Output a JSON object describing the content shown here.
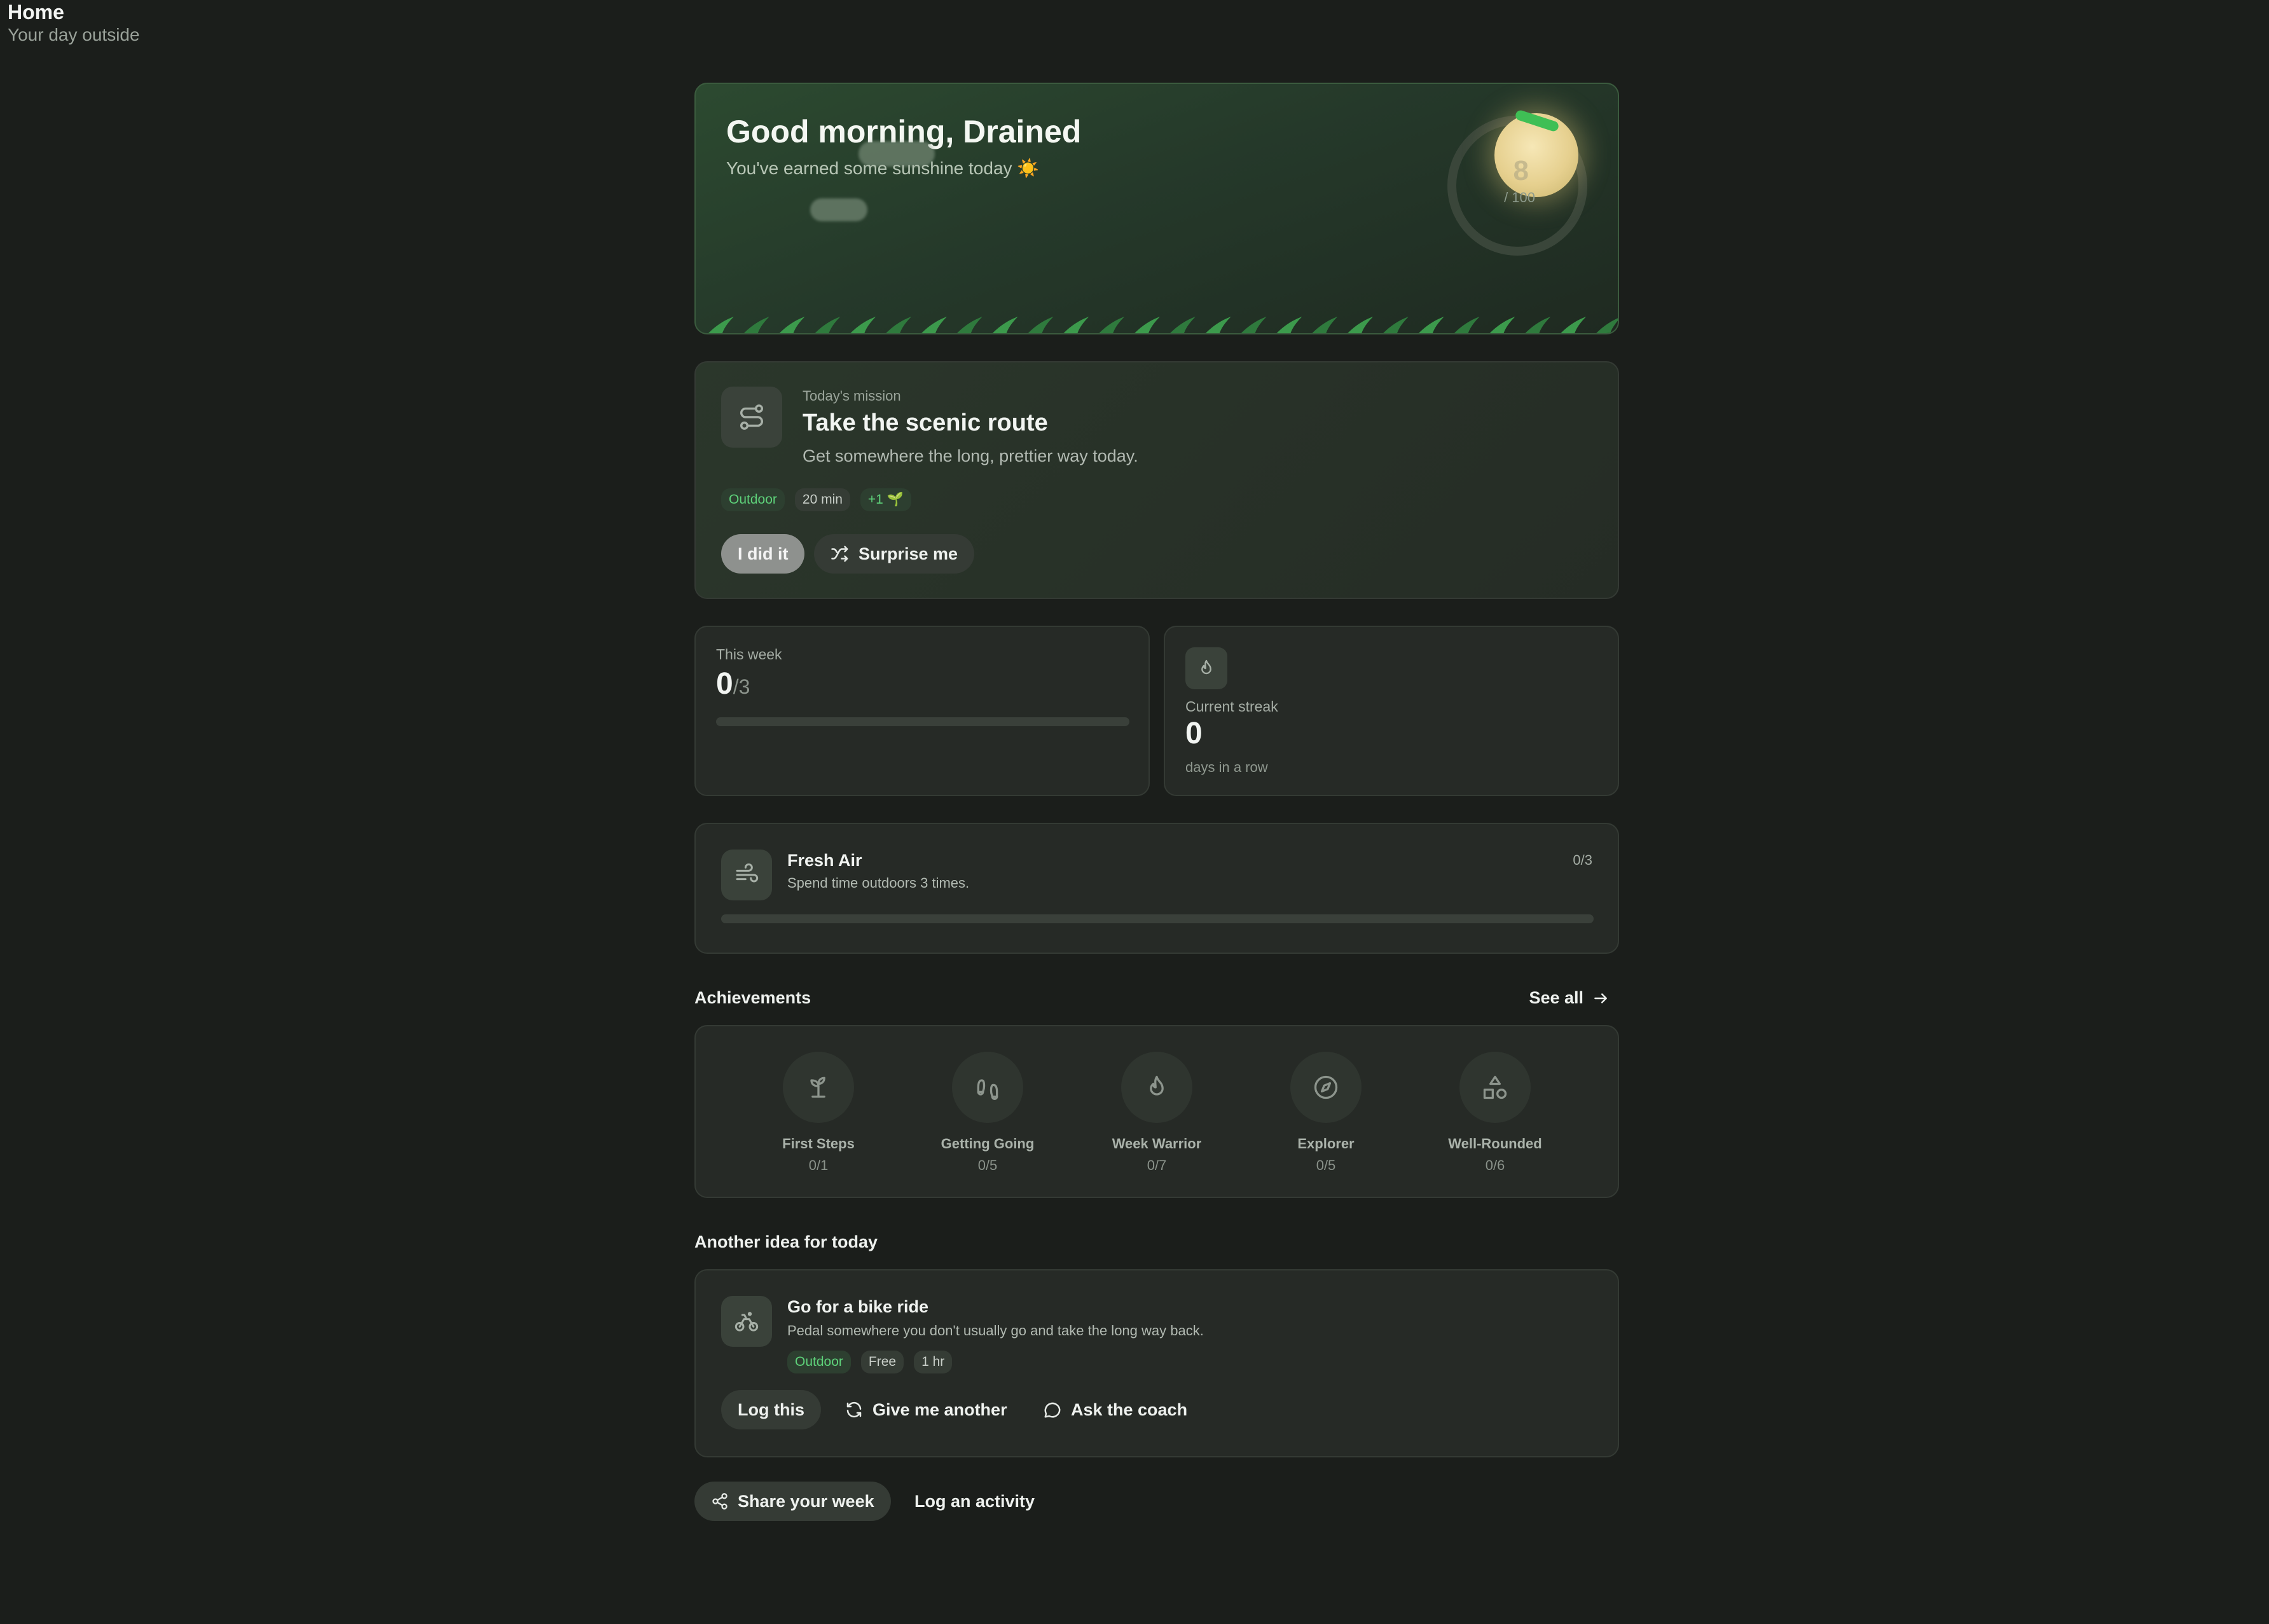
{
  "header": {
    "title": "Home",
    "subtitle": "Your day outside"
  },
  "hero": {
    "greeting": "Good morning, Drained",
    "subtitle": "You've earned some sunshine today ☀️",
    "score": "8",
    "score_max": "/ 100",
    "score_value": 8
  },
  "mission": {
    "kicker": "Today's mission",
    "title": "Take the scenic route",
    "description": "Get somewhere the long, prettier way today.",
    "tags": [
      "Outdoor",
      "20 min",
      "+1 🌱"
    ],
    "done_label": "I did it",
    "surprise_label": "Surprise me",
    "icon": "route-icon"
  },
  "week": {
    "label": "This week",
    "done": "0",
    "total": "/3",
    "progress": 0
  },
  "streak": {
    "label": "Current streak",
    "value": "0",
    "unit": "days in a row",
    "icon": "flame-icon"
  },
  "challenge": {
    "title": "Fresh Air",
    "description": "Spend time outdoors 3 times.",
    "count": "0/3",
    "progress": 0,
    "icon": "wind-icon"
  },
  "achievements": {
    "heading": "Achievements",
    "see_all": "See all",
    "items": [
      {
        "name": "First Steps",
        "progress": "0/1",
        "icon": "sprout-icon"
      },
      {
        "name": "Getting Going",
        "progress": "0/5",
        "icon": "footprints-icon"
      },
      {
        "name": "Week Warrior",
        "progress": "0/7",
        "icon": "flame-icon"
      },
      {
        "name": "Explorer",
        "progress": "0/5",
        "icon": "compass-icon"
      },
      {
        "name": "Well-Rounded",
        "progress": "0/6",
        "icon": "shapes-icon"
      }
    ]
  },
  "idea": {
    "heading": "Another idea for today",
    "title": "Go for a bike ride",
    "description": "Pedal somewhere you don't usually go and take the long way back.",
    "tags": [
      "Outdoor",
      "Free",
      "1 hr"
    ],
    "log_label": "Log this",
    "another_label": "Give me another",
    "coach_label": "Ask the coach",
    "icon": "bike-icon"
  },
  "footer": {
    "share_label": "Share your week",
    "log_label": "Log an activity"
  },
  "colors": {
    "accent": "#4fbf66",
    "background": "#1b1e1b",
    "card": "#262a26"
  }
}
